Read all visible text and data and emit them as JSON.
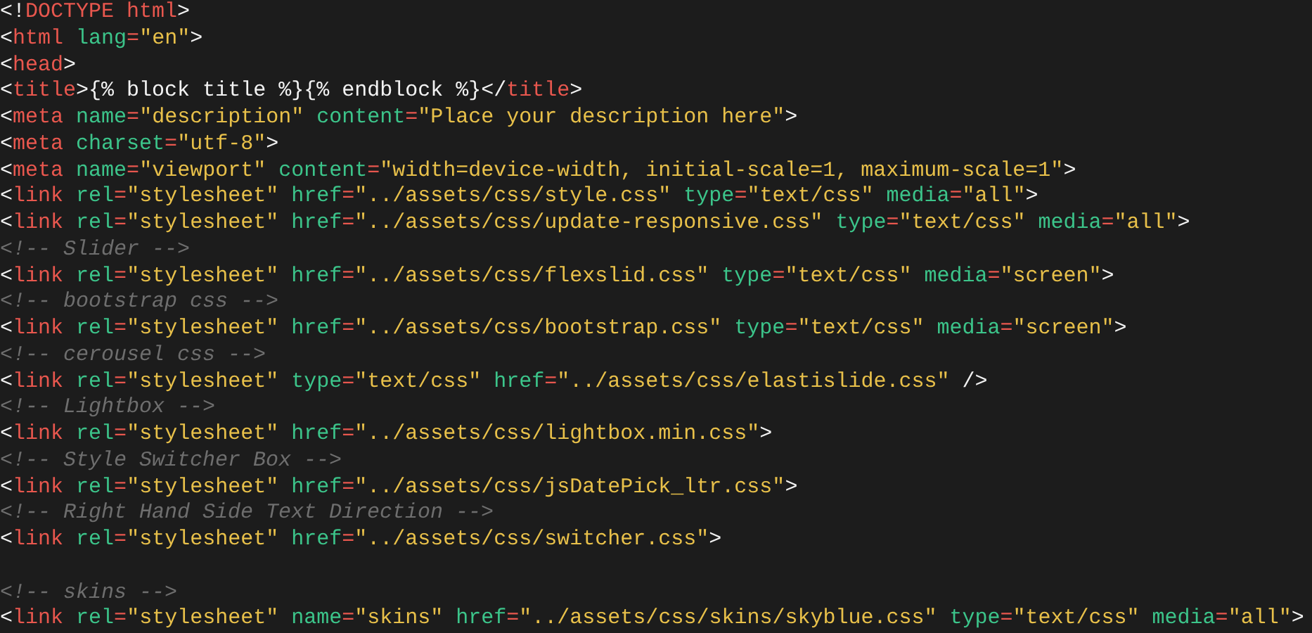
{
  "editor": {
    "lines": [
      {
        "kind": "code",
        "tokens": [
          {
            "kind": "punct",
            "text": "<!"
          },
          {
            "kind": "tag",
            "text": "DOCTYPE html"
          },
          {
            "kind": "punct",
            "text": ">"
          }
        ]
      },
      {
        "kind": "code",
        "tokens": [
          {
            "kind": "punct",
            "text": "<"
          },
          {
            "kind": "tag",
            "text": "html"
          },
          {
            "kind": "attr",
            "text": " lang"
          },
          {
            "kind": "equals",
            "text": "="
          },
          {
            "kind": "string",
            "text": "\"en\""
          },
          {
            "kind": "punct",
            "text": ">"
          }
        ]
      },
      {
        "kind": "code",
        "tokens": [
          {
            "kind": "punct",
            "text": "<"
          },
          {
            "kind": "tag",
            "text": "head"
          },
          {
            "kind": "punct",
            "text": ">"
          }
        ]
      },
      {
        "kind": "code",
        "tokens": [
          {
            "kind": "punct",
            "text": "<"
          },
          {
            "kind": "tag",
            "text": "title"
          },
          {
            "kind": "punct",
            "text": ">"
          },
          {
            "kind": "text",
            "text": "{% block title %}{% endblock %}"
          },
          {
            "kind": "punct",
            "text": "</"
          },
          {
            "kind": "tag",
            "text": "title"
          },
          {
            "kind": "punct",
            "text": ">"
          }
        ]
      },
      {
        "kind": "code",
        "tokens": [
          {
            "kind": "punct",
            "text": "<"
          },
          {
            "kind": "tag",
            "text": "meta"
          },
          {
            "kind": "attr",
            "text": " name"
          },
          {
            "kind": "equals",
            "text": "="
          },
          {
            "kind": "string",
            "text": "\"description\""
          },
          {
            "kind": "attr",
            "text": " content"
          },
          {
            "kind": "equals",
            "text": "="
          },
          {
            "kind": "string",
            "text": "\"Place your description here\""
          },
          {
            "kind": "punct",
            "text": ">"
          }
        ]
      },
      {
        "kind": "code",
        "tokens": [
          {
            "kind": "punct",
            "text": "<"
          },
          {
            "kind": "tag",
            "text": "meta"
          },
          {
            "kind": "attr",
            "text": " charset"
          },
          {
            "kind": "equals",
            "text": "="
          },
          {
            "kind": "string",
            "text": "\"utf-8\""
          },
          {
            "kind": "punct",
            "text": ">"
          }
        ]
      },
      {
        "kind": "code",
        "tokens": [
          {
            "kind": "punct",
            "text": "<"
          },
          {
            "kind": "tag",
            "text": "meta"
          },
          {
            "kind": "attr",
            "text": " name"
          },
          {
            "kind": "equals",
            "text": "="
          },
          {
            "kind": "string",
            "text": "\"viewport\""
          },
          {
            "kind": "attr",
            "text": " content"
          },
          {
            "kind": "equals",
            "text": "="
          },
          {
            "kind": "string",
            "text": "\"width=device-width, initial-scale=1, maximum-scale=1\""
          },
          {
            "kind": "punct",
            "text": ">"
          }
        ]
      },
      {
        "kind": "code",
        "tokens": [
          {
            "kind": "punct",
            "text": "<"
          },
          {
            "kind": "tag",
            "text": "link"
          },
          {
            "kind": "attr",
            "text": " rel"
          },
          {
            "kind": "equals",
            "text": "="
          },
          {
            "kind": "string",
            "text": "\"stylesheet\""
          },
          {
            "kind": "attr",
            "text": " href"
          },
          {
            "kind": "equals",
            "text": "="
          },
          {
            "kind": "string",
            "text": "\"../assets/css/style.css\""
          },
          {
            "kind": "attr",
            "text": " type"
          },
          {
            "kind": "equals",
            "text": "="
          },
          {
            "kind": "string",
            "text": "\"text/css\""
          },
          {
            "kind": "attr",
            "text": " media"
          },
          {
            "kind": "equals",
            "text": "="
          },
          {
            "kind": "string",
            "text": "\"all\""
          },
          {
            "kind": "punct",
            "text": ">"
          }
        ]
      },
      {
        "kind": "code",
        "tokens": [
          {
            "kind": "punct",
            "text": "<"
          },
          {
            "kind": "tag",
            "text": "link"
          },
          {
            "kind": "attr",
            "text": " rel"
          },
          {
            "kind": "equals",
            "text": "="
          },
          {
            "kind": "string",
            "text": "\"stylesheet\""
          },
          {
            "kind": "attr",
            "text": " href"
          },
          {
            "kind": "equals",
            "text": "="
          },
          {
            "kind": "string",
            "text": "\"../assets/css/update-responsive.css\""
          },
          {
            "kind": "attr",
            "text": " type"
          },
          {
            "kind": "equals",
            "text": "="
          },
          {
            "kind": "string",
            "text": "\"text/css\""
          },
          {
            "kind": "attr",
            "text": " media"
          },
          {
            "kind": "equals",
            "text": "="
          },
          {
            "kind": "string",
            "text": "\"all\""
          },
          {
            "kind": "punct",
            "text": ">"
          }
        ]
      },
      {
        "kind": "code",
        "tokens": [
          {
            "kind": "comment",
            "text": "<!-- Slider -->"
          }
        ]
      },
      {
        "kind": "code",
        "tokens": [
          {
            "kind": "punct",
            "text": "<"
          },
          {
            "kind": "tag",
            "text": "link"
          },
          {
            "kind": "attr",
            "text": " rel"
          },
          {
            "kind": "equals",
            "text": "="
          },
          {
            "kind": "string",
            "text": "\"stylesheet\""
          },
          {
            "kind": "attr",
            "text": " href"
          },
          {
            "kind": "equals",
            "text": "="
          },
          {
            "kind": "string",
            "text": "\"../assets/css/flexslid.css\""
          },
          {
            "kind": "attr",
            "text": " type"
          },
          {
            "kind": "equals",
            "text": "="
          },
          {
            "kind": "string",
            "text": "\"text/css\""
          },
          {
            "kind": "attr",
            "text": " media"
          },
          {
            "kind": "equals",
            "text": "="
          },
          {
            "kind": "string",
            "text": "\"screen\""
          },
          {
            "kind": "punct",
            "text": ">"
          }
        ]
      },
      {
        "kind": "code",
        "tokens": [
          {
            "kind": "comment",
            "text": "<!-- bootstrap css -->"
          }
        ]
      },
      {
        "kind": "code",
        "tokens": [
          {
            "kind": "punct",
            "text": "<"
          },
          {
            "kind": "tag",
            "text": "link"
          },
          {
            "kind": "attr",
            "text": " rel"
          },
          {
            "kind": "equals",
            "text": "="
          },
          {
            "kind": "string",
            "text": "\"stylesheet\""
          },
          {
            "kind": "attr",
            "text": " href"
          },
          {
            "kind": "equals",
            "text": "="
          },
          {
            "kind": "string",
            "text": "\"../assets/css/bootstrap.css\""
          },
          {
            "kind": "attr",
            "text": " type"
          },
          {
            "kind": "equals",
            "text": "="
          },
          {
            "kind": "string",
            "text": "\"text/css\""
          },
          {
            "kind": "attr",
            "text": " media"
          },
          {
            "kind": "equals",
            "text": "="
          },
          {
            "kind": "string",
            "text": "\"screen\""
          },
          {
            "kind": "punct",
            "text": ">"
          }
        ]
      },
      {
        "kind": "code",
        "tokens": [
          {
            "kind": "comment",
            "text": "<!-- cerousel css -->"
          }
        ]
      },
      {
        "kind": "code",
        "tokens": [
          {
            "kind": "punct",
            "text": "<"
          },
          {
            "kind": "tag",
            "text": "link"
          },
          {
            "kind": "attr",
            "text": " rel"
          },
          {
            "kind": "equals",
            "text": "="
          },
          {
            "kind": "string",
            "text": "\"stylesheet\""
          },
          {
            "kind": "attr",
            "text": " type"
          },
          {
            "kind": "equals",
            "text": "="
          },
          {
            "kind": "string",
            "text": "\"text/css\""
          },
          {
            "kind": "attr",
            "text": " href"
          },
          {
            "kind": "equals",
            "text": "="
          },
          {
            "kind": "string",
            "text": "\"../assets/css/elastislide.css\""
          },
          {
            "kind": "punct",
            "text": " />"
          }
        ]
      },
      {
        "kind": "code",
        "tokens": [
          {
            "kind": "comment",
            "text": "<!-- Lightbox -->"
          }
        ]
      },
      {
        "kind": "code",
        "tokens": [
          {
            "kind": "punct",
            "text": "<"
          },
          {
            "kind": "tag",
            "text": "link"
          },
          {
            "kind": "attr",
            "text": " rel"
          },
          {
            "kind": "equals",
            "text": "="
          },
          {
            "kind": "string",
            "text": "\"stylesheet\""
          },
          {
            "kind": "attr",
            "text": " href"
          },
          {
            "kind": "equals",
            "text": "="
          },
          {
            "kind": "string",
            "text": "\"../assets/css/lightbox.min.css\""
          },
          {
            "kind": "punct",
            "text": ">"
          }
        ]
      },
      {
        "kind": "code",
        "tokens": [
          {
            "kind": "comment",
            "text": "<!-- Style Switcher Box -->"
          }
        ]
      },
      {
        "kind": "code",
        "tokens": [
          {
            "kind": "punct",
            "text": "<"
          },
          {
            "kind": "tag",
            "text": "link"
          },
          {
            "kind": "attr",
            "text": " rel"
          },
          {
            "kind": "equals",
            "text": "="
          },
          {
            "kind": "string",
            "text": "\"stylesheet\""
          },
          {
            "kind": "attr",
            "text": " href"
          },
          {
            "kind": "equals",
            "text": "="
          },
          {
            "kind": "string",
            "text": "\"../assets/css/jsDatePick_ltr.css\""
          },
          {
            "kind": "punct",
            "text": ">"
          }
        ]
      },
      {
        "kind": "code",
        "tokens": [
          {
            "kind": "comment",
            "text": "<!-- Right Hand Side Text Direction -->"
          }
        ]
      },
      {
        "kind": "code",
        "tokens": [
          {
            "kind": "punct",
            "text": "<"
          },
          {
            "kind": "tag",
            "text": "link"
          },
          {
            "kind": "attr",
            "text": " rel"
          },
          {
            "kind": "equals",
            "text": "="
          },
          {
            "kind": "string",
            "text": "\"stylesheet\""
          },
          {
            "kind": "attr",
            "text": " href"
          },
          {
            "kind": "equals",
            "text": "="
          },
          {
            "kind": "string",
            "text": "\"../assets/css/switcher.css\""
          },
          {
            "kind": "punct",
            "text": ">"
          }
        ]
      },
      {
        "kind": "blank"
      },
      {
        "kind": "code",
        "tokens": [
          {
            "kind": "comment",
            "text": "<!-- skins -->"
          }
        ]
      },
      {
        "kind": "code",
        "tokens": [
          {
            "kind": "punct",
            "text": "<"
          },
          {
            "kind": "tag",
            "text": "link"
          },
          {
            "kind": "attr",
            "text": " rel"
          },
          {
            "kind": "equals",
            "text": "="
          },
          {
            "kind": "string",
            "text": "\"stylesheet\""
          },
          {
            "kind": "attr",
            "text": " name"
          },
          {
            "kind": "equals",
            "text": "="
          },
          {
            "kind": "string",
            "text": "\"skins\""
          },
          {
            "kind": "attr",
            "text": " href"
          },
          {
            "kind": "equals",
            "text": "="
          },
          {
            "kind": "string",
            "text": "\"../assets/css/skins/skyblue.css\""
          },
          {
            "kind": "attr",
            "text": " type"
          },
          {
            "kind": "equals",
            "text": "="
          },
          {
            "kind": "string",
            "text": "\"text/css\""
          },
          {
            "kind": "attr",
            "text": " media"
          },
          {
            "kind": "equals",
            "text": "="
          },
          {
            "kind": "string",
            "text": "\"all\""
          },
          {
            "kind": "punct",
            "text": ">"
          }
        ]
      }
    ]
  }
}
